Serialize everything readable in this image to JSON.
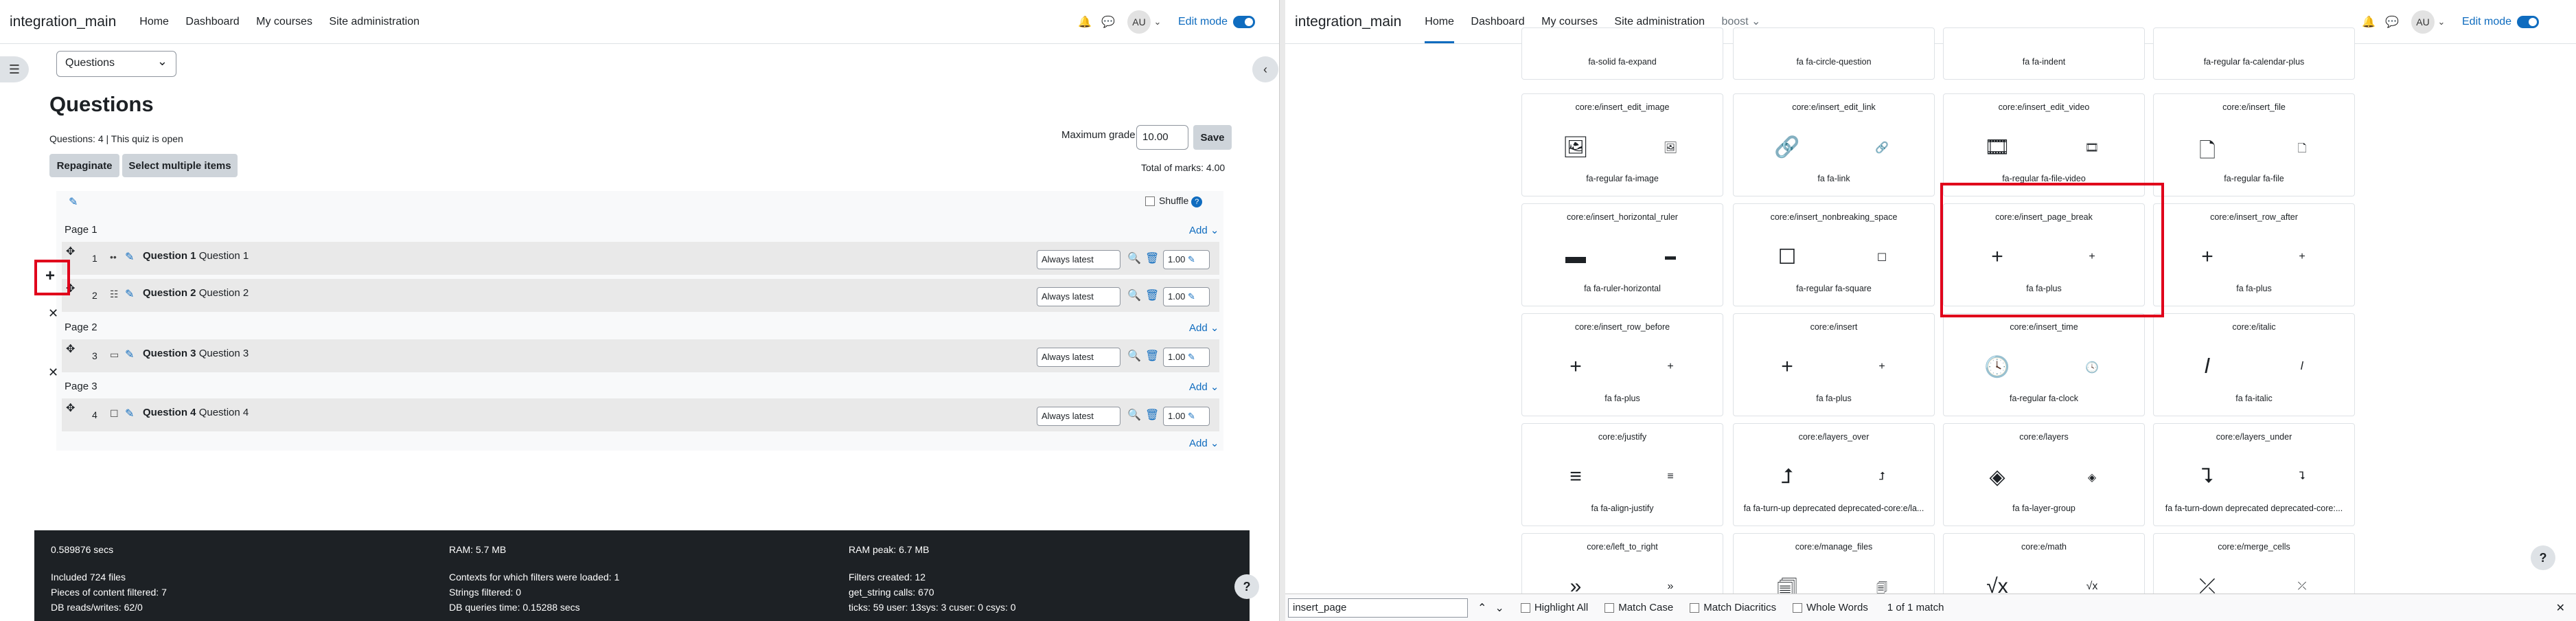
{
  "left": {
    "brand": "integration_main",
    "nav": [
      "Home",
      "Dashboard",
      "My courses",
      "Site administration"
    ],
    "avatar": "AU",
    "edit_mode": "Edit mode",
    "select_value": "Questions",
    "page_title": "Questions",
    "quiz_info": "Questions: 4 | This quiz is open",
    "repaginate": "Repaginate",
    "select_multiple": "Select multiple items",
    "max_grade_label": "Maximum grade",
    "max_grade_value": "10.00",
    "save": "Save",
    "total_marks": "Total of marks: 4.00",
    "shuffle": "Shuffle",
    "add": "Add",
    "pages": [
      "Page 1",
      "Page 2",
      "Page 3"
    ],
    "questions": [
      {
        "num": "1",
        "title": "Question 1",
        "text": "Question 1",
        "version": "Always latest",
        "mark": "1.00"
      },
      {
        "num": "2",
        "title": "Question 2",
        "text": "Question 2",
        "version": "Always latest",
        "mark": "1.00"
      },
      {
        "num": "3",
        "title": "Question 3",
        "text": "Question 3",
        "version": "Always latest",
        "mark": "1.00"
      },
      {
        "num": "4",
        "title": "Question 4",
        "text": "Question 4",
        "version": "Always latest",
        "mark": "1.00"
      }
    ],
    "footer": {
      "c1": [
        "0.589876 secs",
        "Included 724 files",
        "Pieces of content filtered: 7",
        "DB reads/writes: 62/0"
      ],
      "c2": [
        "RAM: 5.7 MB",
        "Contexts for which filters were loaded: 1",
        "Strings filtered: 0",
        "DB queries time: 0.15288 secs"
      ],
      "c3": [
        "RAM peak: 6.7 MB",
        "Filters created: 12",
        "get_string calls: 670",
        "ticks: 59 user: 13sys: 3 cuser: 0 csys: 0"
      ]
    }
  },
  "right": {
    "brand": "integration_main",
    "nav": [
      "Home",
      "Dashboard",
      "My courses",
      "Site administration",
      "boost"
    ],
    "avatar": "AU",
    "edit_mode": "Edit mode",
    "top_row": [
      "fa-solid fa-expand",
      "fa fa-circle-question",
      "fa fa-indent",
      "fa-regular fa-calendar-plus"
    ],
    "cards": [
      {
        "name": "core:e/insert_edit_image",
        "fa": "fa-regular fa-image",
        "icon": "image-icon",
        "g": "🖼"
      },
      {
        "name": "core:e/insert_edit_link",
        "fa": "fa fa-link",
        "icon": "link-icon",
        "g": "🔗"
      },
      {
        "name": "core:e/insert_edit_video",
        "fa": "fa-regular fa-file-video",
        "icon": "file-video-icon",
        "g": "🎞"
      },
      {
        "name": "core:e/insert_file",
        "fa": "fa-regular fa-file",
        "icon": "file-icon",
        "g": "🗋"
      },
      {
        "name": "core:e/insert_horizontal_ruler",
        "fa": "fa fa-ruler-horizontal",
        "icon": "ruler-icon",
        "g": "▬"
      },
      {
        "name": "core:e/insert_nonbreaking_space",
        "fa": "fa-regular fa-square",
        "icon": "square-icon",
        "g": "☐"
      },
      {
        "name": "core:e/insert_page_break",
        "fa": "fa fa-plus",
        "icon": "plus-icon",
        "g": "+"
      },
      {
        "name": "core:e/insert_row_after",
        "fa": "fa fa-plus",
        "icon": "plus-icon",
        "g": "+"
      },
      {
        "name": "core:e/insert_row_before",
        "fa": "fa fa-plus",
        "icon": "plus-icon",
        "g": "+"
      },
      {
        "name": "core:e/insert",
        "fa": "fa fa-plus",
        "icon": "plus-icon",
        "g": "+"
      },
      {
        "name": "core:e/insert_time",
        "fa": "fa-regular fa-clock",
        "icon": "clock-icon",
        "g": "🕓"
      },
      {
        "name": "core:e/italic",
        "fa": "fa fa-italic",
        "icon": "italic-icon",
        "g": "𝐼"
      },
      {
        "name": "core:e/justify",
        "fa": "fa fa-align-justify",
        "icon": "align-justify-icon",
        "g": "≡"
      },
      {
        "name": "core:e/layers_over",
        "fa": "fa fa-turn-up deprecated deprecated-core:e/la...",
        "icon": "turn-up-icon",
        "g": "⮥"
      },
      {
        "name": "core:e/layers",
        "fa": "fa fa-layer-group",
        "icon": "layer-group-icon",
        "g": "◈"
      },
      {
        "name": "core:e/layers_under",
        "fa": "fa fa-turn-down deprecated deprecated-core:...",
        "icon": "turn-down-icon",
        "g": "⮧"
      },
      {
        "name": "core:e/left_to_right",
        "fa": "",
        "icon": "angles-right-icon",
        "g": "»"
      },
      {
        "name": "core:e/manage_files",
        "fa": "",
        "icon": "files-icon",
        "g": "🗐"
      },
      {
        "name": "core:e/math",
        "fa": "",
        "icon": "square-root-icon",
        "g": "√x"
      },
      {
        "name": "core:e/merge_cells",
        "fa": "",
        "icon": "compress-icon",
        "g": "⤫"
      }
    ],
    "find": {
      "value": "insert_page",
      "highlight_all": "Highlight All",
      "match_case": "Match Case",
      "match_diacritics": "Match Diacritics",
      "whole_words": "Whole Words",
      "status": "1 of 1 match"
    }
  }
}
